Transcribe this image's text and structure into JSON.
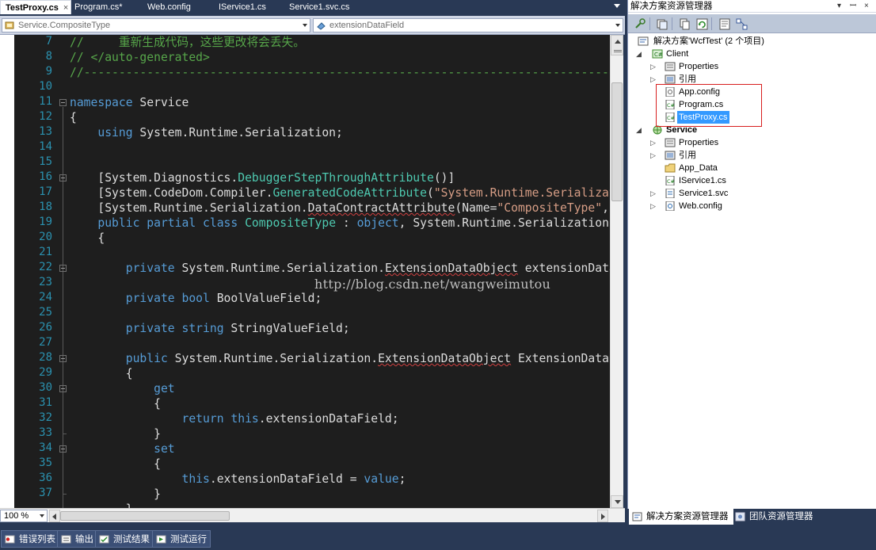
{
  "editor_tabs": [
    {
      "label": "TestProxy.cs",
      "active": true,
      "close": "×"
    },
    {
      "label": "Program.cs*",
      "active": false
    },
    {
      "label": "Web.config",
      "active": false
    },
    {
      "label": "IService1.cs",
      "active": false
    },
    {
      "label": "Service1.svc.cs",
      "active": false
    }
  ],
  "navbar": {
    "type_combo": "Service.CompositeType",
    "member_combo": "extensionDataField"
  },
  "editor": {
    "line_numbers": [
      "7",
      "8",
      "9",
      "10",
      "11",
      "12",
      "13",
      "14",
      "15",
      "16",
      "17",
      "18",
      "19",
      "20",
      "21",
      "22",
      "23",
      "24",
      "25",
      "26",
      "27",
      "28",
      "29",
      "30",
      "31",
      "32",
      "33",
      "34",
      "35",
      "36",
      "37"
    ],
    "watermark": "http://blog.csdn.net/wangweimutou",
    "colors": {
      "keyword": "#569cd6",
      "comment": "#57a64a",
      "type": "#4ec9b0",
      "string": "#d69d85",
      "text": "#dcdcdc",
      "line_number": "#2b91af",
      "background": "#1e1e1e"
    }
  },
  "bottombar": {
    "zoom": "100 %"
  },
  "solution_explorer": {
    "title": "解决方案资源管理器",
    "title_controls": [
      "▾",
      "ꟷ",
      "×"
    ],
    "tree": [
      {
        "label": "解决方案'WcfTest' (2 个项目)",
        "icon": "solution-icon"
      },
      {
        "label": "Client",
        "icon": "csharp-project-icon",
        "expander": "◢"
      },
      {
        "label": "Properties",
        "icon": "properties-icon",
        "expander": "▷"
      },
      {
        "label": "引用",
        "icon": "references-icon",
        "expander": "▷"
      },
      {
        "label": "App.config",
        "icon": "config-file-icon"
      },
      {
        "label": "Program.cs",
        "icon": "cs-file-icon"
      },
      {
        "label": "TestProxy.cs",
        "icon": "cs-file-icon",
        "selected": true
      },
      {
        "label": "Service",
        "icon": "web-project-icon",
        "expander": "◢"
      },
      {
        "label": "Properties",
        "icon": "properties-icon",
        "expander": "▷"
      },
      {
        "label": "引用",
        "icon": "references-icon",
        "expander": "▷"
      },
      {
        "label": "App_Data",
        "icon": "folder-icon"
      },
      {
        "label": "IService1.cs",
        "icon": "cs-file-icon"
      },
      {
        "label": "Service1.svc",
        "icon": "svc-file-icon",
        "expander": "▷"
      },
      {
        "label": "Web.config",
        "icon": "config-file-icon",
        "expander": "▷"
      }
    ],
    "bottom_tabs": [
      {
        "label": "解决方案资源管理器",
        "active": true
      },
      {
        "label": "团队资源管理器",
        "active": false
      }
    ]
  },
  "output_tabs": [
    {
      "label": "错误列表"
    },
    {
      "label": "输出"
    },
    {
      "label": "测试结果"
    },
    {
      "label": "测试运行"
    }
  ]
}
